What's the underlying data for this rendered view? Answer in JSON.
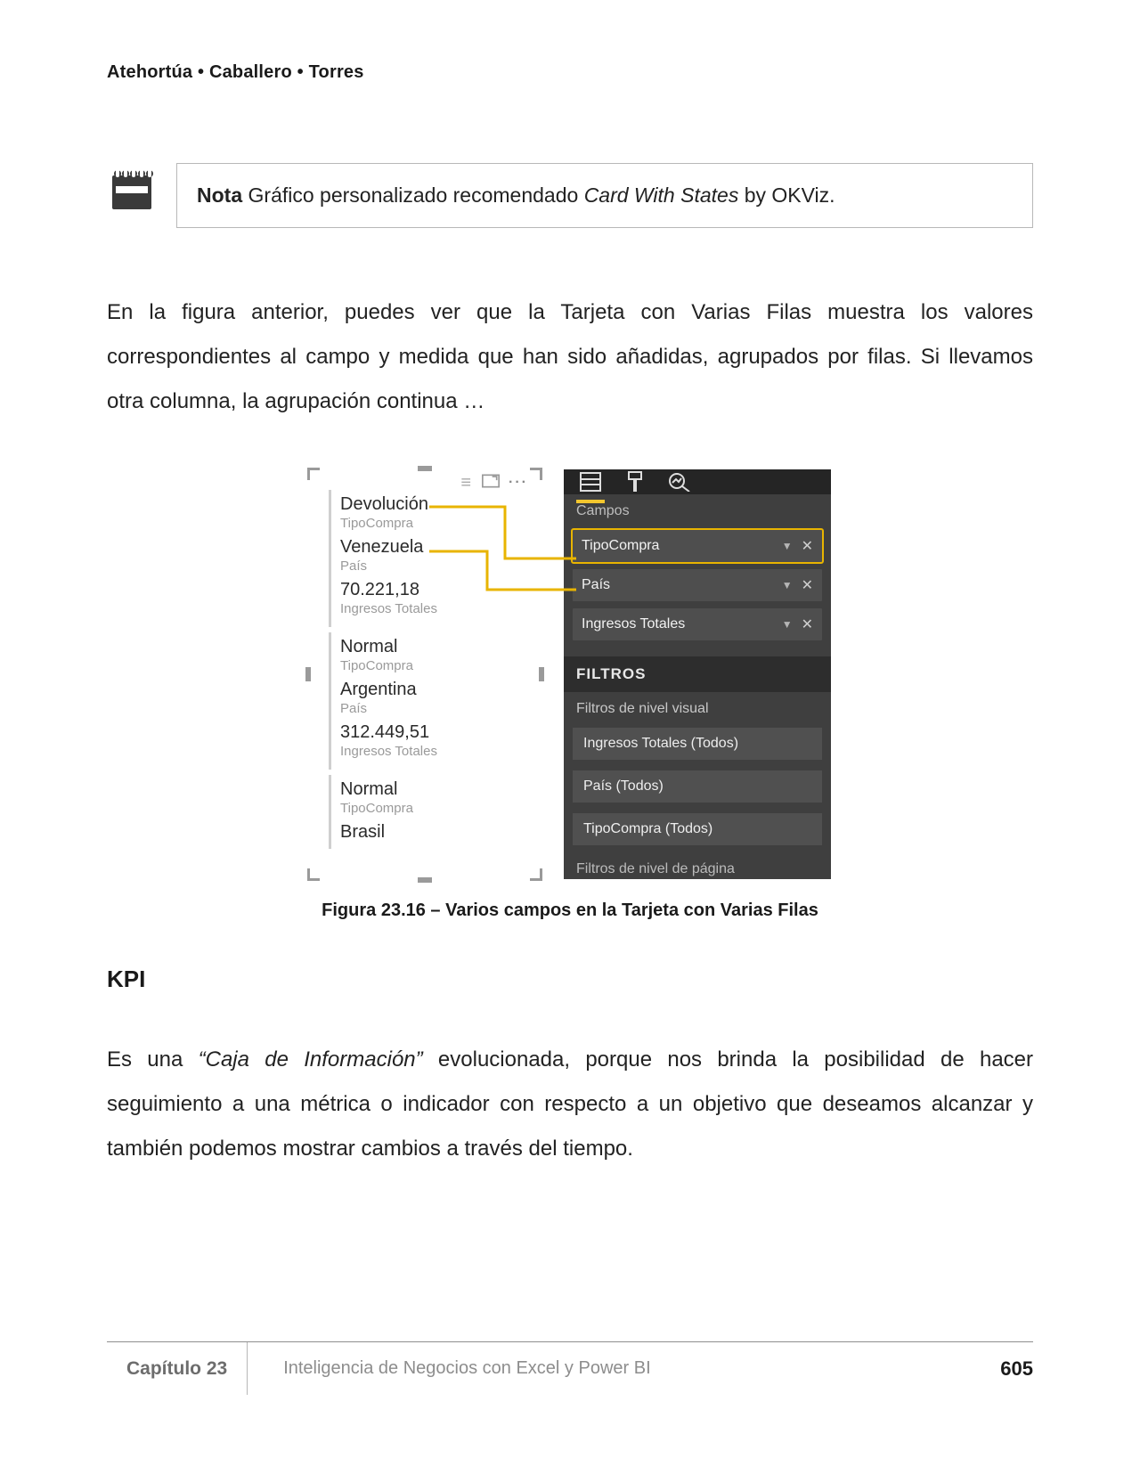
{
  "header": {
    "authors": "Atehortúa • Caballero • Torres"
  },
  "note": {
    "label": "Nota",
    "text_prefix": " Gráfico personalizado recomendado ",
    "visual_name": "Card With States",
    "text_suffix": " by OKViz."
  },
  "paragraph1": "En la figura anterior, puedes ver que la Tarjeta con Varias Filas muestra los valores correspondientes al campo y medida que han sido añadidas, agrupados por filas. Si llevamos otra columna, la agrupación continua …",
  "figure": {
    "caption": "Figura 23.16 – Varios campos en la Tarjeta con Varias Filas",
    "card_rows": [
      {
        "value": "Devolución",
        "label": "TipoCompra"
      },
      {
        "value": "Venezuela",
        "label": "País"
      },
      {
        "value": "70.221,18",
        "label": "Ingresos Totales"
      },
      {
        "value": "Normal",
        "label": "TipoCompra"
      },
      {
        "value": "Argentina",
        "label": "País"
      },
      {
        "value": "312.449,51",
        "label": "Ingresos Totales"
      },
      {
        "value": "Normal",
        "label": "TipoCompra"
      },
      {
        "value": "Brasil",
        "label": ""
      }
    ],
    "panel": {
      "section_fields_label": "Campos",
      "fields": [
        {
          "name": "TipoCompra",
          "highlight": true
        },
        {
          "name": "País",
          "highlight": false
        },
        {
          "name": "Ingresos Totales",
          "highlight": false
        }
      ],
      "filters_header": "FILTROS",
      "visual_filters_label": "Filtros de nivel visual",
      "filters": [
        "Ingresos Totales (Todos)",
        "País (Todos)",
        "TipoCompra (Todos)"
      ],
      "page_filters_label": "Filtros de nivel de página"
    }
  },
  "kpi_heading": "KPI",
  "paragraph2_pre": "Es una ",
  "paragraph2_quote": "“Caja de Información”",
  "paragraph2_post": " evolucionada, porque nos brinda la posibilidad de hacer seguimiento a una métrica o indicador con respecto a un objetivo que deseamos alcanzar y también podemos mostrar cambios a través del tiempo.",
  "footer": {
    "chapter": "Capítulo 23",
    "title": "Inteligencia de Negocios con Excel y Power BI",
    "page": "605"
  }
}
